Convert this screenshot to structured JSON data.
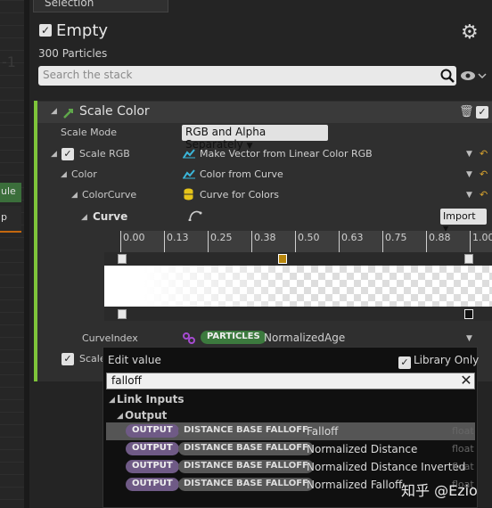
{
  "left_graph": {
    "corner_text": "-1",
    "node1_label": "ule",
    "node2_label": "p"
  },
  "selection_tab": "Selection",
  "header": {
    "title": "Empty",
    "subtitle": "300 Particles"
  },
  "search": {
    "placeholder": "Search the stack"
  },
  "module": {
    "title": "Scale Color",
    "rows": {
      "scale_mode_label": "Scale Mode",
      "scale_mode_value": "RGB and Alpha Separately",
      "scale_rgb_label": "Scale RGB",
      "scale_rgb_value": "Make Vector from Linear Color RGB",
      "color_label": "Color",
      "color_value": "Color from Curve",
      "colorcurve_label": "ColorCurve",
      "colorcurve_value": "Curve for Colors",
      "curve_label": "Curve",
      "import_label": "Import",
      "curveindex_label": "CurveIndex",
      "curveindex_badge": "PARTICLES",
      "curveindex_value": "NormalizedAge",
      "scale_a_label": "Scale"
    },
    "ruler_ticks": [
      "0.00",
      "0.13",
      "0.25",
      "0.38",
      "0.50",
      "0.63",
      "0.75",
      "0.88",
      "1.00"
    ]
  },
  "popup": {
    "title": "Edit value",
    "library_only": "Library Only",
    "query": "falloff",
    "category": "Link Inputs",
    "subcategory": "Output",
    "results": [
      {
        "badge": "OUTPUT",
        "source": "DISTANCE BASE FALLOFF",
        "name": "Falloff",
        "type": "float"
      },
      {
        "badge": "OUTPUT",
        "source": "DISTANCE BASE FALLOFF",
        "name": "Normalized Distance",
        "type": "float"
      },
      {
        "badge": "OUTPUT",
        "source": "DISTANCE BASE FALLOFF",
        "name": "Normalized Distance Inverted",
        "type": "float"
      },
      {
        "badge": "OUTPUT",
        "source": "DISTANCE BASE FALLOFF",
        "name": "Normalized Falloff",
        "type": "float"
      }
    ]
  },
  "watermark": "知乎 @Ezio",
  "colors": {
    "accent_green": "#7ec43a",
    "badge_particles": "#3c7a3e",
    "badge_output": "#6f5a86"
  }
}
